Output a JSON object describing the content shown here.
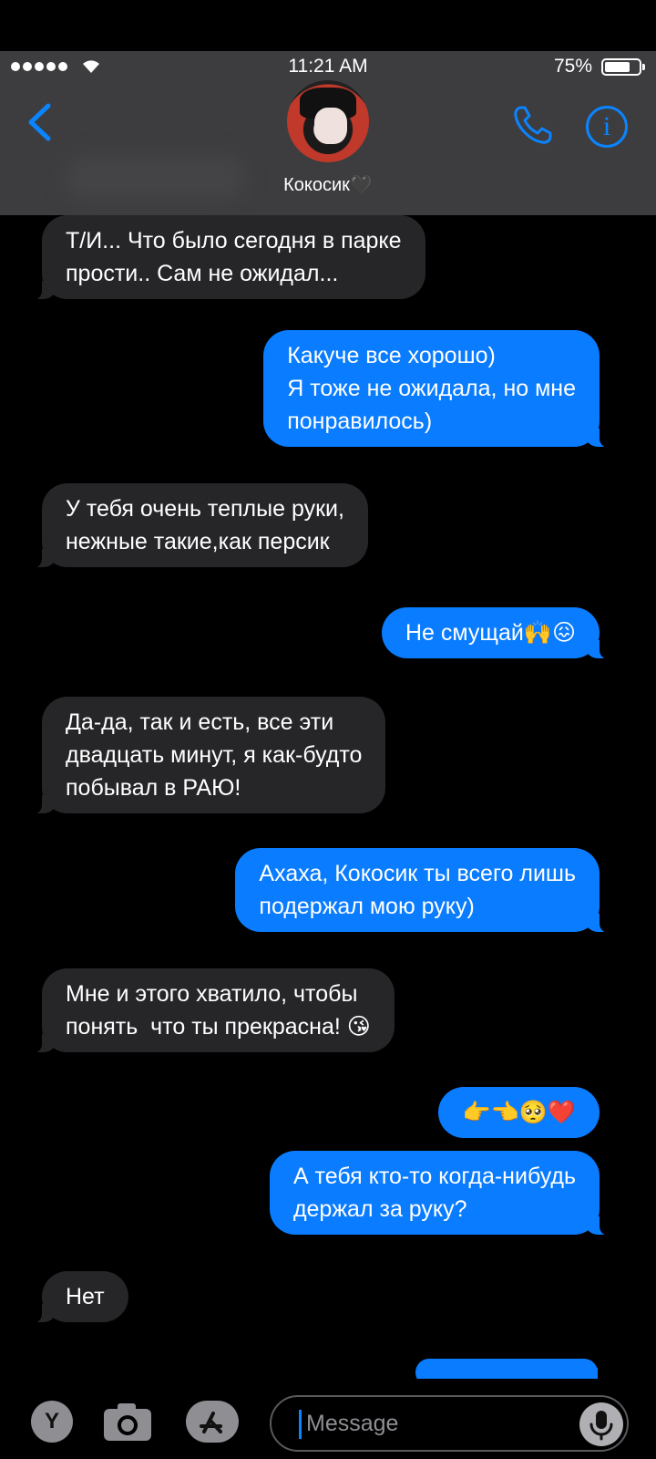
{
  "status_bar": {
    "time": "11:21 AM",
    "battery": "75%",
    "battery_level": 0.75,
    "signal_dots": 5
  },
  "header": {
    "contact_name": "Кокосик🖤",
    "back_icon": "chevron-left-icon",
    "phone_icon": "phone-icon",
    "info_icon": "info-icon",
    "info_glyph": "i"
  },
  "messages": [
    {
      "direction": "in",
      "text": "Т/И... Что было сегодня в парке\nпрости.. Сам не ожидал..."
    },
    {
      "direction": "out",
      "text": "Какуче все хорошо)\nЯ тоже не ожидала, но мне\nпонравилось)"
    },
    {
      "direction": "in",
      "text": "У тебя очень теплые руки,\nнежные такие,как персик"
    },
    {
      "direction": "out",
      "text": "Не смущай🙌😖"
    },
    {
      "direction": "in",
      "text": "Да-да, так и есть, все эти\nдвадцать минут, я как-будто\nпобывал в РАЮ!"
    },
    {
      "direction": "out",
      "text": "Ахаха, Кокосик ты всего лишь\nподержал мою руку)"
    },
    {
      "direction": "in",
      "text": "Мне и этого хватило, чтобы\nпонять  что ты прекрасна! 😘"
    },
    {
      "direction": "out",
      "text": "👉👈🥺❤️"
    },
    {
      "direction": "out",
      "text": "А тебя кто-то когда-нибудь\nдержал за руку?"
    },
    {
      "direction": "in",
      "text": "Нет"
    }
  ],
  "composer": {
    "app_button_label": "Y",
    "camera_icon": "camera-icon",
    "appstore_icon": "appstore-icon",
    "placeholder": "Message",
    "mic_icon": "microphone-icon"
  },
  "colors": {
    "incoming_bubble": "#262629",
    "outgoing_bubble": "#0a7cff",
    "accent": "#0a84ff",
    "header_bg": "#3d3d3f"
  }
}
